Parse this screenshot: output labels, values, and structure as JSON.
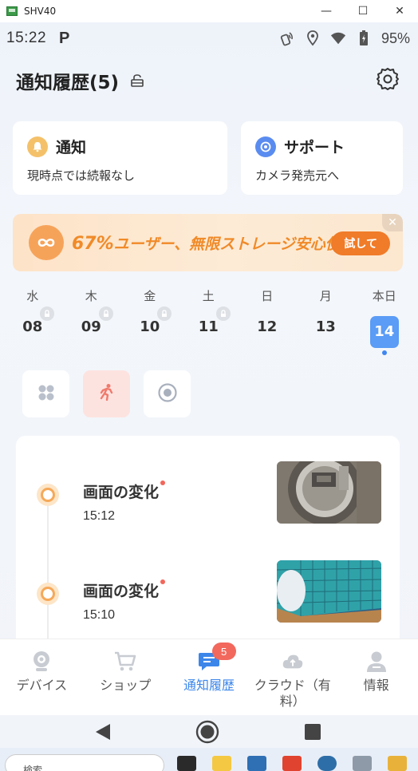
{
  "window": {
    "title": "SHV40",
    "minimize": "—",
    "maximize": "☐",
    "close": "✕"
  },
  "status_bar": {
    "time": "15:22",
    "p_icon": "P",
    "battery": "95%",
    "icons": [
      "nfc-icon",
      "location-icon",
      "wifi-icon",
      "battery-icon"
    ]
  },
  "header": {
    "title": "通知履歴(5)",
    "lock_icon": "lock-icon",
    "settings_icon": "gear-icon"
  },
  "cards": [
    {
      "title": "通知",
      "subtitle": "現時点では続報なし",
      "icon": "bell-icon",
      "color": "#f4c16a"
    },
    {
      "title": "サポート",
      "subtitle": "カメラ発売元へ",
      "icon": "support-icon",
      "color": "#5a8cf0"
    }
  ],
  "promo": {
    "percent": "67%",
    "text": "ユーザー、無限ストレージ安心使う",
    "button": "試して",
    "close": "✕"
  },
  "days": [
    {
      "weekday": "水",
      "num": "08",
      "locked": true
    },
    {
      "weekday": "木",
      "num": "09",
      "locked": true
    },
    {
      "weekday": "金",
      "num": "10",
      "locked": true
    },
    {
      "weekday": "土",
      "num": "11",
      "locked": true
    },
    {
      "weekday": "日",
      "num": "12",
      "locked": false
    },
    {
      "weekday": "月",
      "num": "13",
      "locked": false
    },
    {
      "weekday": "本日",
      "num": "14",
      "locked": false,
      "today": true
    }
  ],
  "filters": [
    {
      "icon": "grid-icon",
      "active": false
    },
    {
      "icon": "motion-person-icon",
      "active": true
    },
    {
      "icon": "record-icon",
      "active": false
    }
  ],
  "events": [
    {
      "title": "画面の変化",
      "time": "15:12"
    },
    {
      "title": "画面の変化",
      "time": "15:10"
    }
  ],
  "tabs": [
    {
      "label": "デバイス",
      "icon": "camera-icon"
    },
    {
      "label": "ショップ",
      "icon": "cart-icon"
    },
    {
      "label": "通知履歴",
      "icon": "message-icon",
      "badge": "5",
      "active": true
    },
    {
      "label": "クラウド（有料）",
      "icon": "cloud-icon"
    },
    {
      "label": "情報",
      "icon": "person-icon"
    }
  ],
  "taskbar": {
    "search": "検索"
  },
  "colors": {
    "accent": "#3c86ea",
    "orange": "#f07b28",
    "badge": "#f2685d",
    "timeline": "#f5a95a"
  }
}
